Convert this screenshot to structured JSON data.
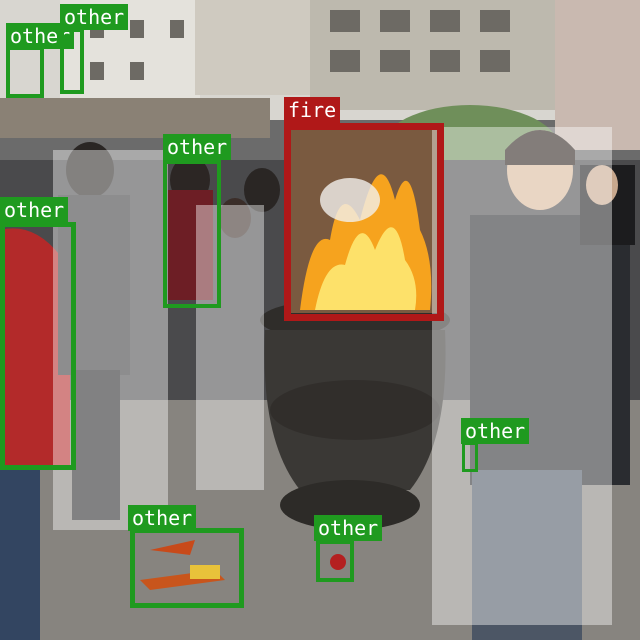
{
  "scene": {
    "description_colors": {
      "fire_box": "#b01818",
      "other_box": "#1f9a1f",
      "fire_label_bg": "#b01818",
      "other_label_bg": "#1f9a1f"
    }
  },
  "detections": [
    {
      "label": "other",
      "kind": "other"
    },
    {
      "label": "other",
      "kind": "other"
    },
    {
      "label": "fire",
      "kind": "fire"
    },
    {
      "label": "other",
      "kind": "other"
    },
    {
      "label": "other",
      "kind": "other"
    },
    {
      "label": "other",
      "kind": "other"
    },
    {
      "label": "other",
      "kind": "other"
    },
    {
      "label": "other",
      "kind": "other"
    }
  ]
}
